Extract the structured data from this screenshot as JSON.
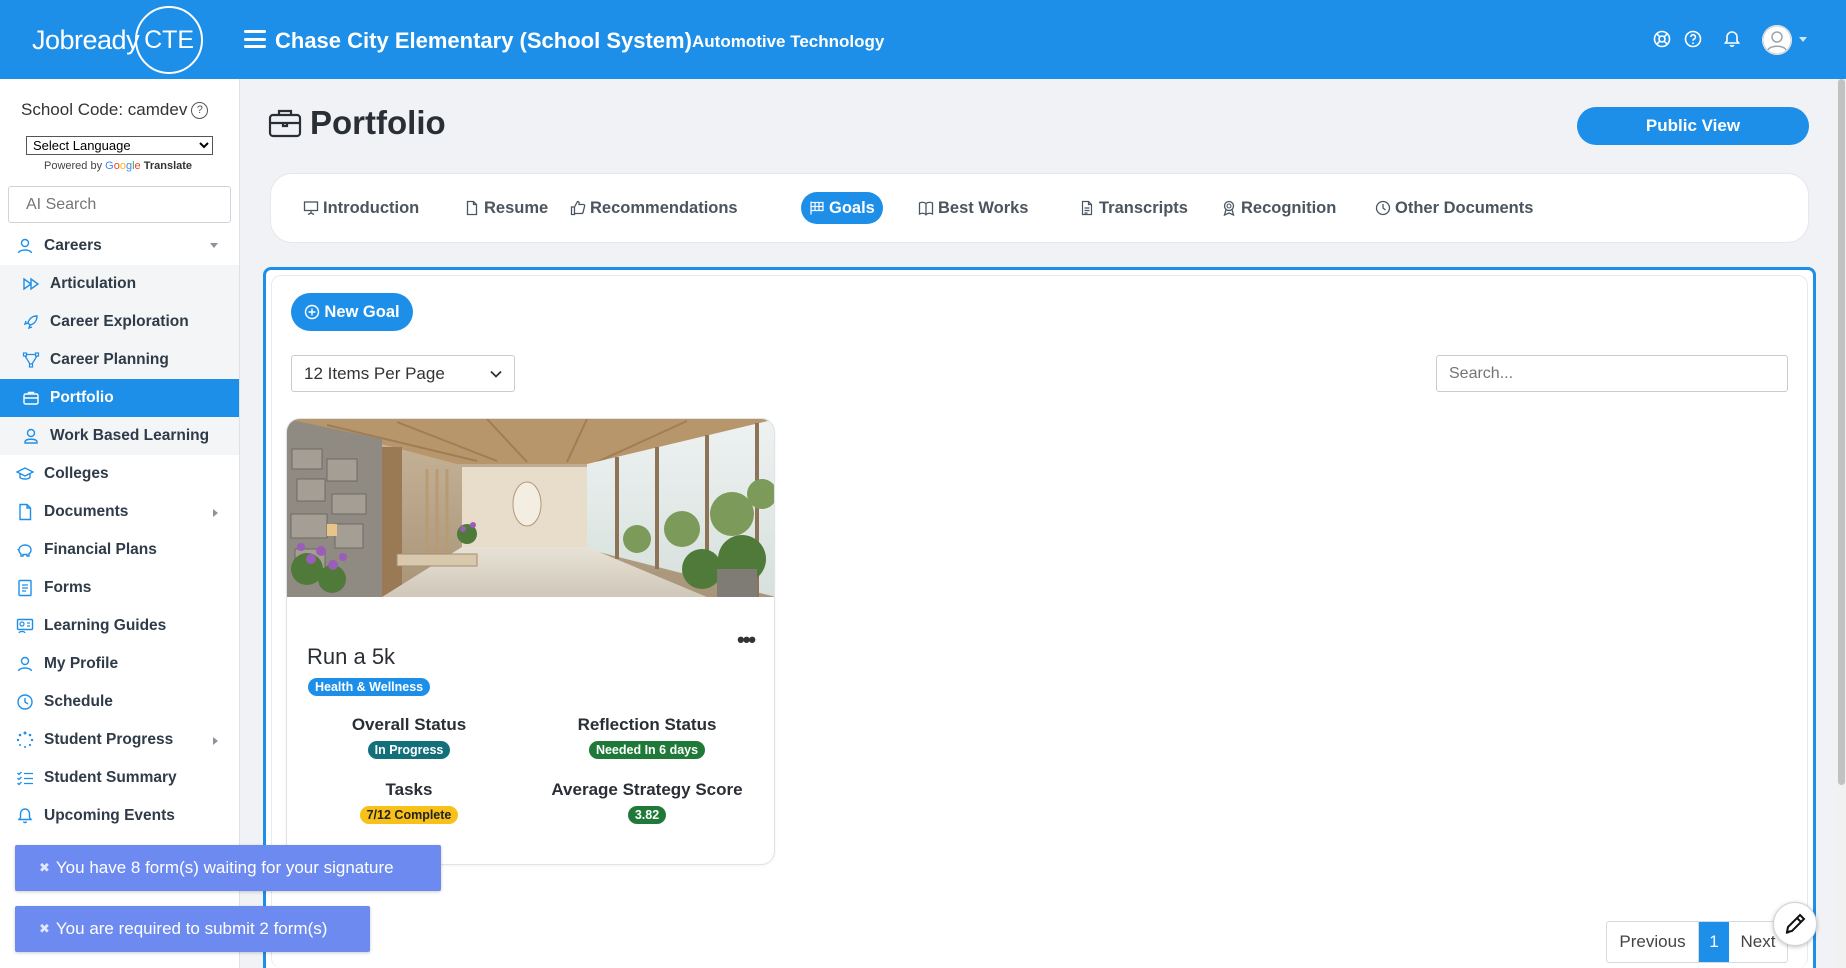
{
  "header": {
    "logo_text": "Jobready",
    "logo_circle": "CTE",
    "school_name": "Chase City Elementary (School System)",
    "program": "Automotive Technology",
    "icons": [
      "lifebuoy-icon",
      "help-icon",
      "bell-icon",
      "user-avatar-icon"
    ]
  },
  "sidebar": {
    "school_code": "School Code: camdev",
    "language_select": "Select Language",
    "powered_by": "Powered by",
    "google": [
      "G",
      "o",
      "o",
      "g",
      "l",
      "e"
    ],
    "translate": "Translate",
    "ai_search_placeholder": "AI Search",
    "items": [
      {
        "label": "Careers",
        "icon": "person-icon",
        "caret": "down"
      },
      {
        "label": "Articulation",
        "icon": "fast-forward-icon",
        "sub": true
      },
      {
        "label": "Career Exploration",
        "icon": "rocket-icon",
        "sub": true
      },
      {
        "label": "Career Planning",
        "icon": "vector-icon",
        "sub": true
      },
      {
        "label": "Portfolio",
        "icon": "briefcase-icon",
        "sub": true,
        "active": true
      },
      {
        "label": "Work Based Learning",
        "icon": "person-badge-icon",
        "sub": true
      },
      {
        "label": "Colleges",
        "icon": "mortarboard-icon"
      },
      {
        "label": "Documents",
        "icon": "file-icon",
        "caret": "right"
      },
      {
        "label": "Financial Plans",
        "icon": "piggy-bank-icon"
      },
      {
        "label": "Forms",
        "icon": "form-icon"
      },
      {
        "label": "Learning Guides",
        "icon": "guide-icon"
      },
      {
        "label": "My Profile",
        "icon": "person-icon"
      },
      {
        "label": "Schedule",
        "icon": "clock-icon"
      },
      {
        "label": "Student Progress",
        "icon": "loader-icon",
        "caret": "right"
      },
      {
        "label": "Student Summary",
        "icon": "list-check-icon"
      },
      {
        "label": "Upcoming Events",
        "icon": "bell-icon"
      }
    ]
  },
  "main": {
    "title": "Portfolio",
    "public_view": "Public View",
    "tabs": [
      {
        "label": "Introduction",
        "icon": "presentation-icon"
      },
      {
        "label": "Resume",
        "icon": "file-icon"
      },
      {
        "label": "Recommendations",
        "icon": "thumbs-up-icon"
      },
      {
        "label": "Goals",
        "icon": "flag-grid-icon",
        "active": true
      },
      {
        "label": "Best Works",
        "icon": "book-icon"
      },
      {
        "label": "Transcripts",
        "icon": "file-text-icon"
      },
      {
        "label": "Recognition",
        "icon": "award-icon"
      },
      {
        "label": "Other Documents",
        "icon": "clock-icon"
      }
    ],
    "new_goal": "New Goal",
    "per_page": "12 Items Per Page",
    "search_placeholder": "Search...",
    "goal": {
      "title": "Run a 5k",
      "category": "Health & Wellness",
      "overall_status_label": "Overall Status",
      "overall_status": "In Progress",
      "reflection_status_label": "Reflection Status",
      "reflection_status": "Needed In 6 days",
      "tasks_label": "Tasks",
      "tasks": "7/12 Complete",
      "strategy_label": "Average Strategy Score",
      "strategy_score": "3.82",
      "more": "•••"
    },
    "pager": {
      "prev": "Previous",
      "page": "1",
      "next": "Next"
    }
  },
  "toasts": [
    {
      "text": "You have 8 form(s) waiting for your signature",
      "close": "✖"
    },
    {
      "text": "You are required to submit 2 form(s)",
      "close": "✖"
    }
  ],
  "colors": {
    "primary": "#1e8fe8",
    "toast": "#6c8af0",
    "teal": "#13707a",
    "green": "#1f7a3a",
    "yellow": "#f7c11a"
  }
}
